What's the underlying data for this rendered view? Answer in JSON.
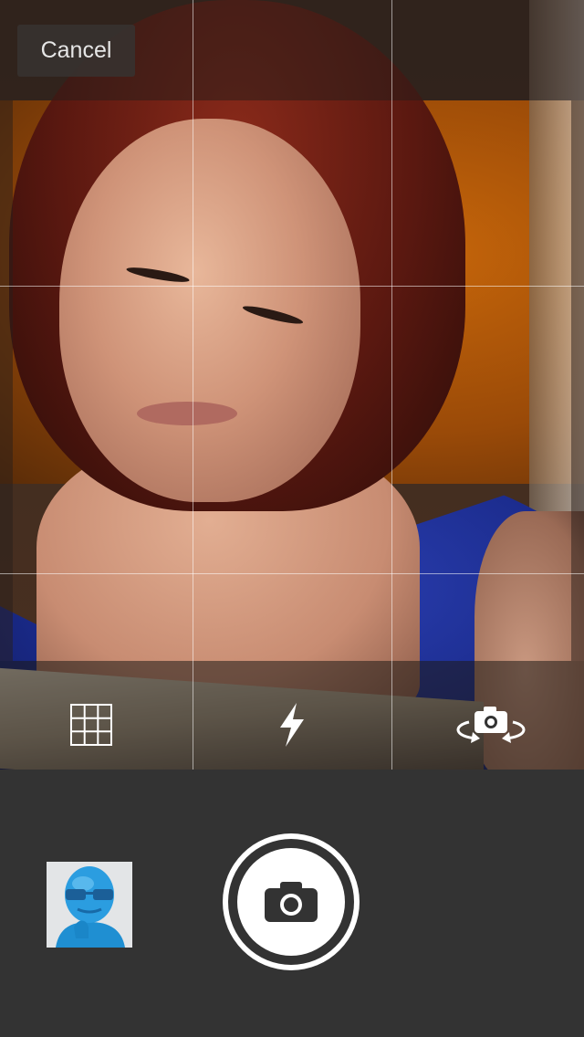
{
  "header": {
    "cancel_label": "Cancel"
  },
  "toolbar": {
    "grid_icon": "grid-icon",
    "flash_icon": "flash-icon",
    "switch_camera_icon": "switch-camera-icon"
  },
  "capture": {
    "shutter_icon": "camera-icon",
    "last_photo_thumbnail": "gallery-thumbnail"
  },
  "colors": {
    "bottom_bar": "#333333",
    "gridline": "#ffffff",
    "shutter": "#ffffff"
  }
}
